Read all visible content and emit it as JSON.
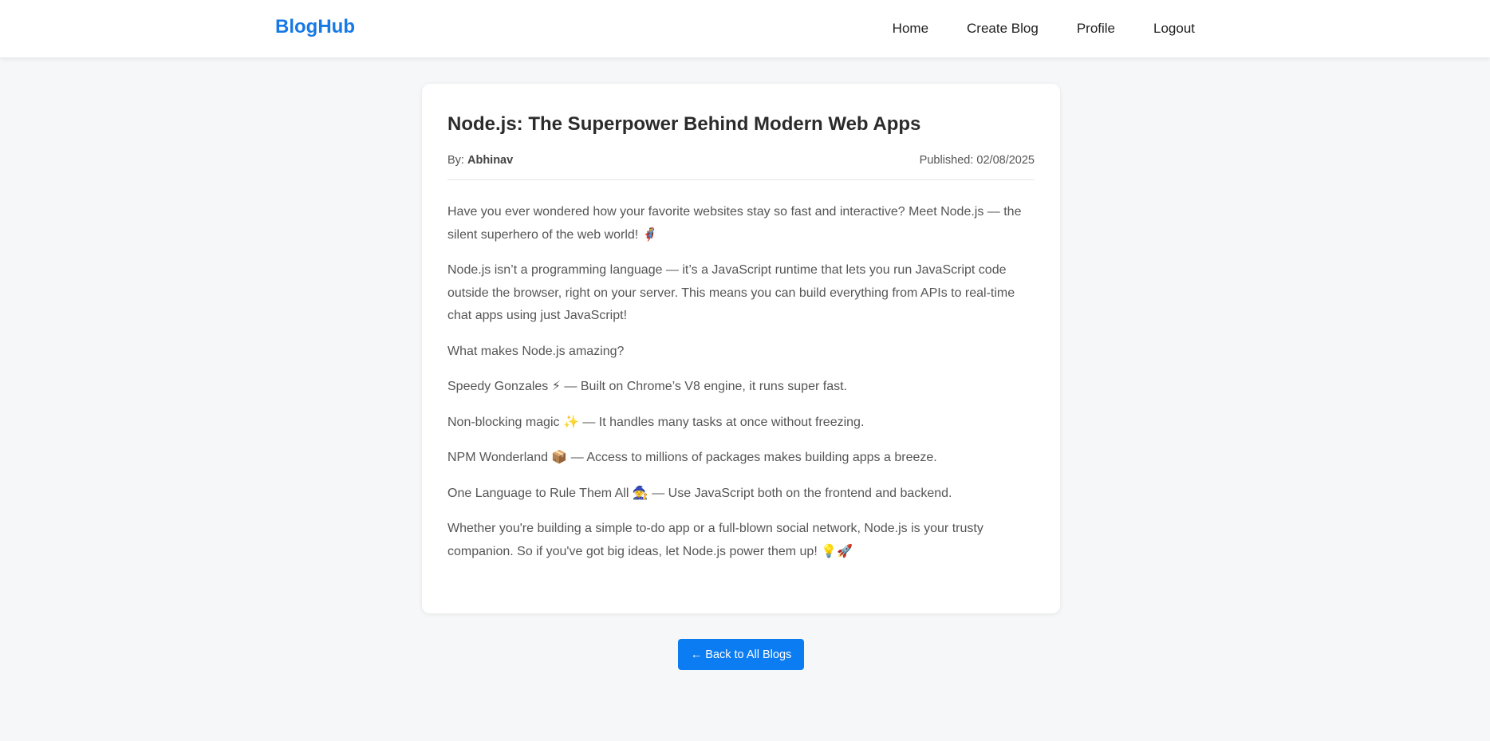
{
  "navbar": {
    "brand": "BlogHub",
    "links": [
      {
        "label": "Home"
      },
      {
        "label": "Create Blog"
      },
      {
        "label": "Profile"
      },
      {
        "label": "Logout"
      }
    ]
  },
  "post": {
    "title": "Node.js: The Superpower Behind Modern Web Apps",
    "author_prefix": "By:",
    "author": "Abhinav",
    "published": "Published: 02/08/2025",
    "paragraphs": [
      "Have you ever wondered how your favorite websites stay so fast and interactive? Meet Node.js — the silent superhero of the web world! 🦸",
      "Node.js isn’t a programming language — it’s a JavaScript runtime that lets you run JavaScript code outside the browser, right on your server. This means you can build everything from APIs to real-time chat apps using just JavaScript!",
      "What makes Node.js amazing?",
      "Speedy Gonzales ⚡ — Built on Chrome’s V8 engine, it runs super fast.",
      "Non-blocking magic ✨ — It handles many tasks at once without freezing.",
      "NPM Wonderland 📦 — Access to millions of packages makes building apps a breeze.",
      "One Language to Rule Them All 🧙 — Use JavaScript both on the frontend and backend.",
      "Whether you're building a simple to-do app or a full-blown social network, Node.js is your trusty companion. So if you've got big ideas, let Node.js power them up! 💡🚀"
    ]
  },
  "back_button": {
    "label": "← Back to All Blogs"
  },
  "colors": {
    "brand": "#1779e6",
    "button": "#0b7cf2",
    "background": "#f6f7f8"
  }
}
